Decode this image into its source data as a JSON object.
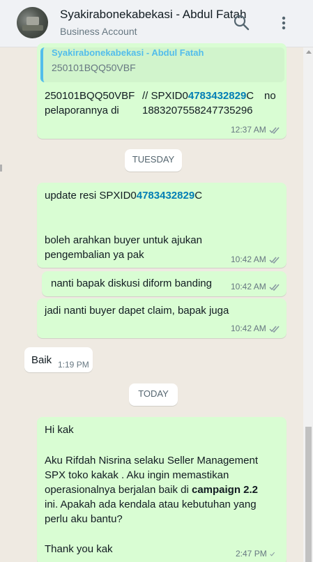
{
  "header": {
    "title": "Syakirabonekabekasi - Abdul Fatah",
    "subtitle": "Business Account",
    "search_icon": "search-icon",
    "menu_icon": "menu-dots-icon"
  },
  "colors": {
    "outgoing_bubble": "#d9fdd3",
    "incoming_bubble": "#ffffff",
    "quote_accent": "#53bdeb",
    "link_blue": "#027eb5",
    "chat_background": "#efeae2"
  },
  "messages": {
    "m1": {
      "quote_name": "Syakirabonekabekasi - Abdul Fatah",
      "quote_text": "250101BQQ50VBF",
      "line1_a": "250101BQQ50VBF",
      "line1_b": "// SPXID0",
      "line1_link": "4783432829",
      "line1_c": "C",
      "line1_d": "no",
      "line2_a": "pelaporannya di",
      "line2_b": "1883207558247735296",
      "time": "12:37 AM"
    },
    "divider1": "TUESDAY",
    "m2": {
      "line1_a": "update resi SPXID0",
      "line1_link": "4783432829",
      "line1_c": "C",
      "line2": "boleh arahkan buyer untuk ajukan",
      "line3": "pengembalian ya pak",
      "time": "10:42 AM"
    },
    "m3": {
      "text": "nanti bapak diskusi diform banding",
      "time": "10:42 AM"
    },
    "m4": {
      "text": "jadi nanti buyer dapet claim, bapak juga",
      "time": "10:42 AM"
    },
    "m5": {
      "text": "Baik",
      "time": "1:19 PM"
    },
    "divider2": "TODAY",
    "m6": {
      "line1": "Hi kak",
      "line2": "Aku Rifdah Nisrina selaku Seller Management",
      "line3": "SPX toko kakak . Aku ingin memastikan",
      "line4a": "operasionalnya berjalan baik di",
      "line4b": "campaign 2.2",
      "line5": "ini. Apakah ada kendala atau kebutuhan yang",
      "line6": "perlu aku bantu?",
      "line7": "Thank you kak",
      "time": "2:47 PM"
    }
  }
}
